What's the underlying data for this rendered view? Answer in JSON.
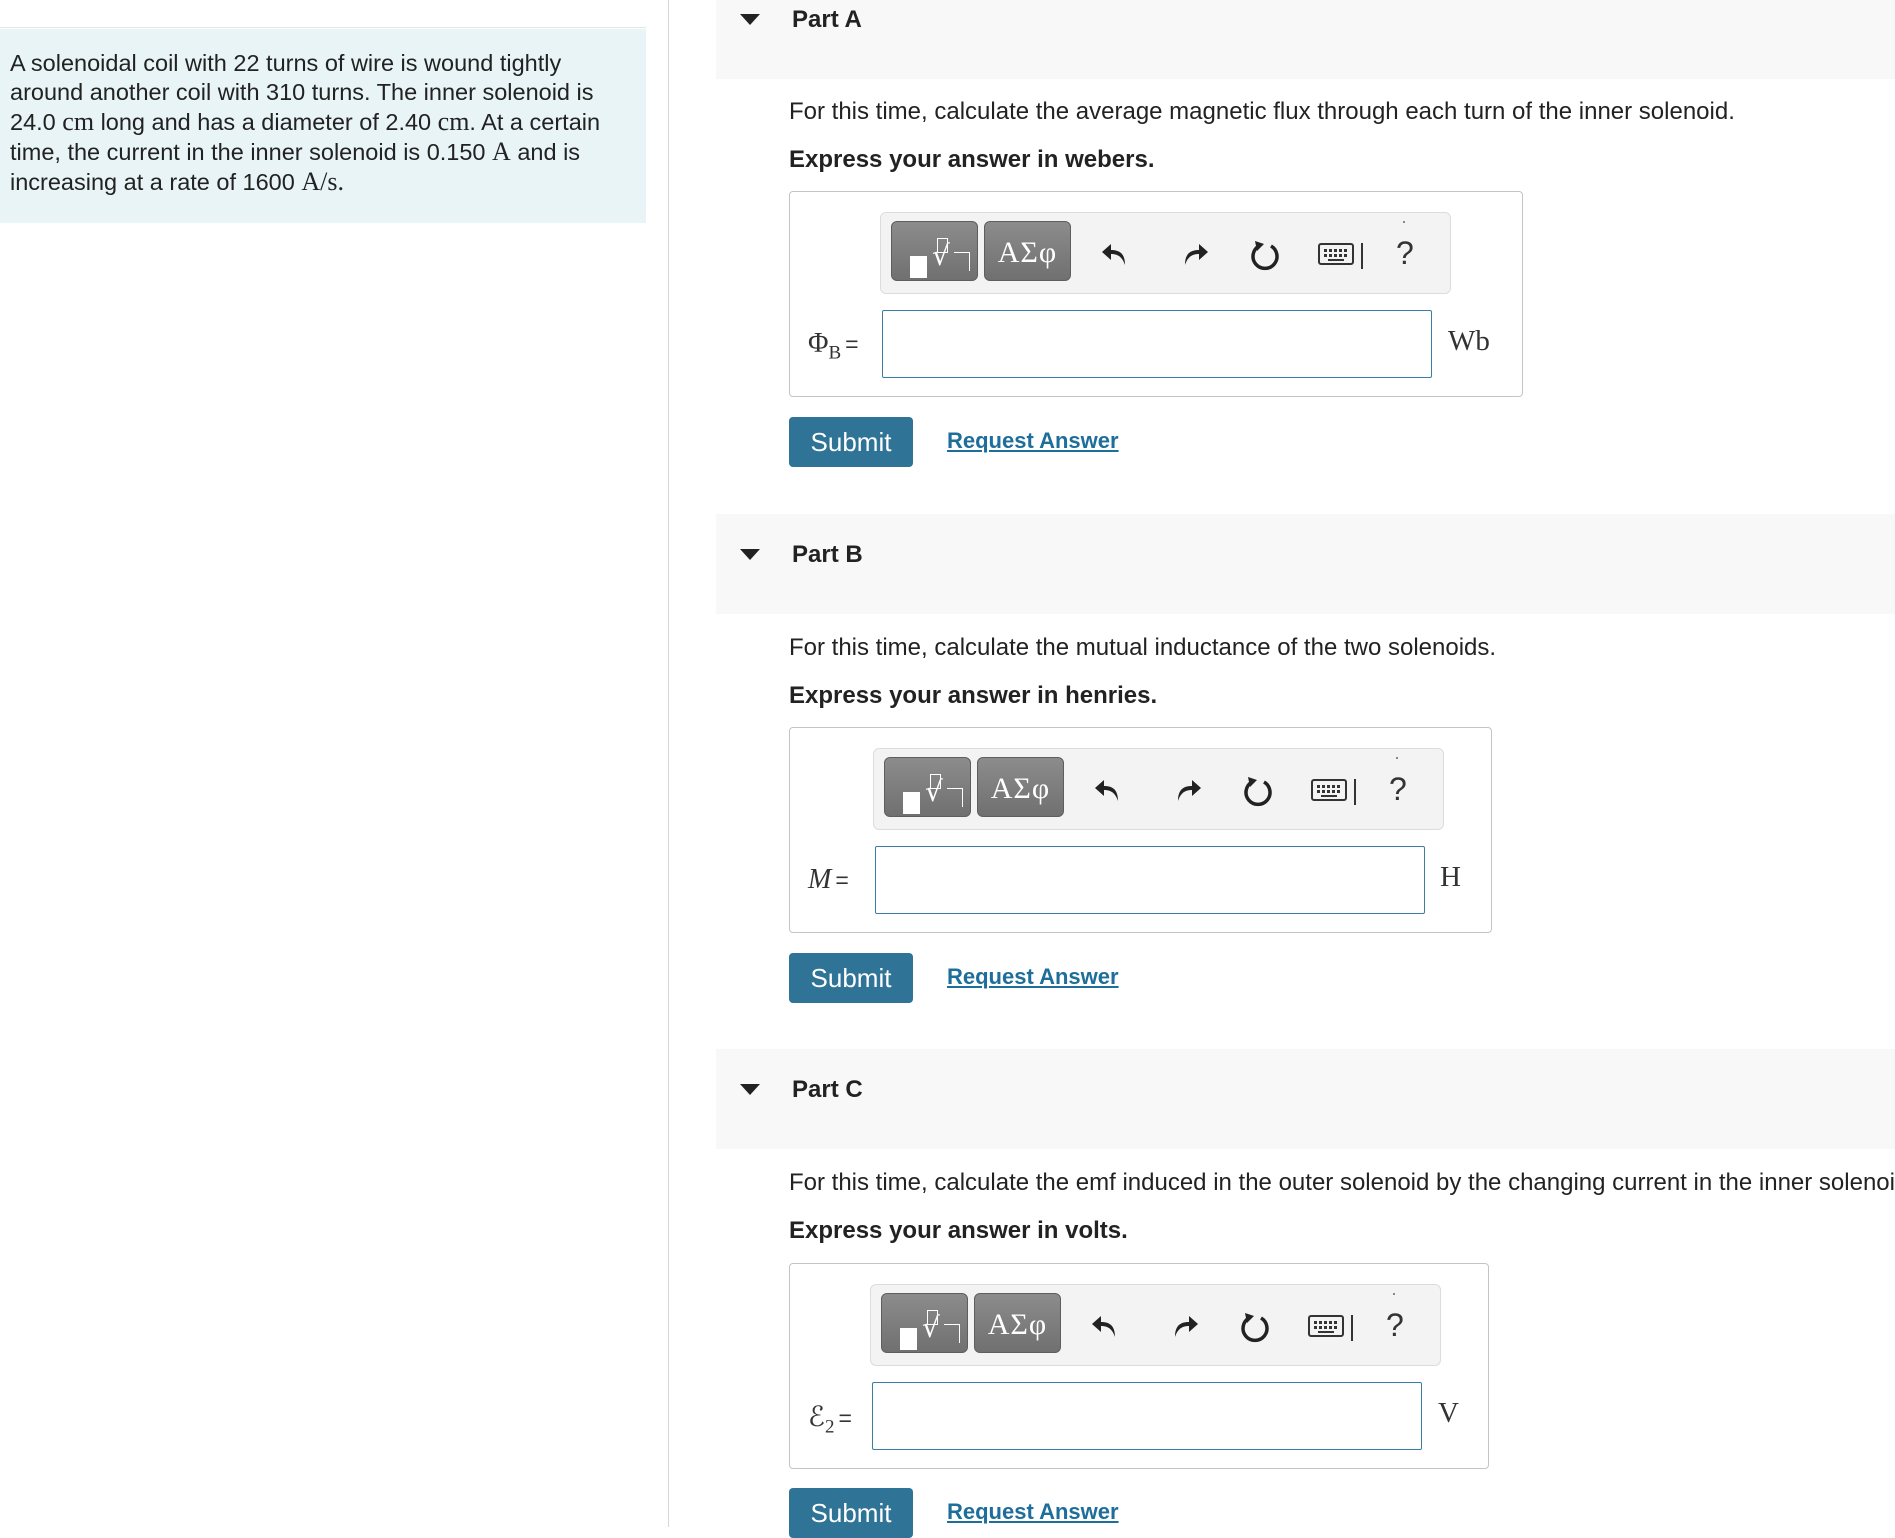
{
  "problem": {
    "segments": {
      "s1": "A solenoidal coil with 22 turns of wire is wound tightly around another coil with 310 turns. The inner solenoid is 24.0 ",
      "u1": "cm",
      "s2": " long and has a diameter of 2.40 ",
      "u2": "cm",
      "s3": ". At a certain time, the current in the inner solenoid is 0.150 ",
      "u3": "A",
      "s4": " and is increasing at a rate of 1600 ",
      "u4": "A/s",
      "s5": "."
    }
  },
  "toolbar": {
    "templates_icon": "templates-radical-icon",
    "greek_label": "ΑΣφ",
    "undo_icon": "undo-icon",
    "redo_icon": "redo-icon",
    "reset_icon": "reset-icon",
    "keyboard_icon": "keyboard-icon",
    "help_label": "?"
  },
  "parts": [
    {
      "title": "Part A",
      "question": "For this time, calculate the average magnetic flux through each turn of the inner solenoid.",
      "instruction": "Express your answer in webers.",
      "variable": "Φ",
      "variable_sub": "B",
      "equals": "=",
      "value": "",
      "unit": "Wb",
      "submit_label": "Submit",
      "request_label": "Request Answer"
    },
    {
      "title": "Part B",
      "question": "For this time, calculate the mutual inductance of the two solenoids.",
      "instruction": "Express your answer in henries.",
      "variable": "M",
      "variable_sub": "",
      "equals": "=",
      "value": "",
      "unit": "H",
      "submit_label": "Submit",
      "request_label": "Request Answer"
    },
    {
      "title": "Part C",
      "question": "For this time, calculate the emf induced in the outer solenoid by the changing current in the inner solenoid.",
      "instruction": "Express your answer in volts.",
      "variable": "ℰ",
      "variable_sub": "2",
      "equals": "=",
      "value": "",
      "unit": "V",
      "submit_label": "Submit",
      "request_label": "Request Answer"
    }
  ],
  "colors": {
    "problem_bg": "#e8f4f6",
    "submit_bg": "#2f7396",
    "link": "#1e6e9b",
    "input_border": "#3a7ea6"
  }
}
